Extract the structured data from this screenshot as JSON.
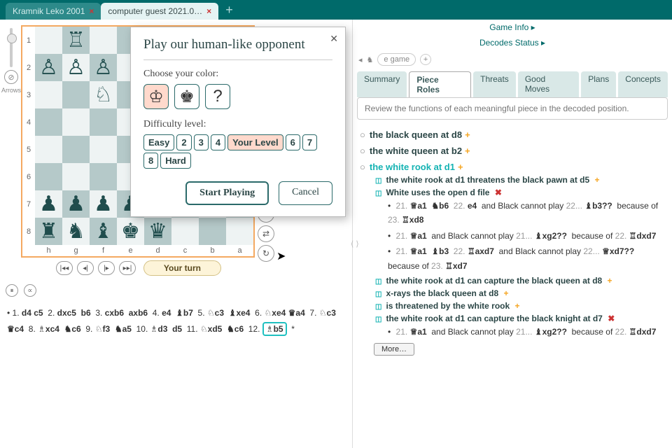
{
  "tabs": [
    {
      "label": "Kramnik Leko 2001",
      "active": false
    },
    {
      "label": "computer guest 2021.0…",
      "active": true
    }
  ],
  "sidebar": {
    "arrows": "Arrows"
  },
  "board": {
    "ranks": [
      "1",
      "2",
      "3",
      "4",
      "5",
      "6",
      "7",
      "8"
    ],
    "files": [
      "h",
      "g",
      "f",
      "e",
      "d",
      "c",
      "b",
      "a"
    ],
    "turn_badge": "Your turn"
  },
  "nav": {
    "first": "⏮",
    "prev": "◁",
    "next": "▷",
    "last": "⏭"
  },
  "notation_text": "• 1. d4 c5 2. dxc5 b6 3. cxb6 axb6 4. e4 ♝b7 5. ♘c3 ♝xe4 6. ♘xe4 ♛a4 7. ♘c3 ♛c4 8. ♗xc4 ♞c6 9. ♘f3 ♞a5 10. ♗d3 d5 11. ♘xd5 ♞c6 12. ♗b5 *",
  "notation_highlight": "♗b5",
  "right": {
    "game_info": "Game Info ▸",
    "decodes": "Decodes Status ▸",
    "chips": [
      "◂",
      "♞",
      "e game",
      "+"
    ],
    "tabs": [
      "Summary",
      "Piece Roles",
      "Threats",
      "Good Moves",
      "Plans",
      "Concepts"
    ],
    "current_tab": 1,
    "desc": "Review the functions of each meaningful piece in the decoded position."
  },
  "analysis": [
    {
      "type": "head",
      "text": "the black queen at d8",
      "mark": "+"
    },
    {
      "type": "head",
      "text": "the white queen at b2",
      "mark": "+"
    },
    {
      "type": "head",
      "text": "the white rook at d1",
      "mark": "+",
      "teal": true,
      "children": [
        {
          "type": "sub",
          "text": "the white rook at d1 threatens the black pawn at d5",
          "mark": "+"
        },
        {
          "type": "sub",
          "text": "White uses the open d file",
          "mark": "x",
          "lines": [
            "• 21. ♕a1 ♞b6 22. e4 and Black cannot play 22... ♝b3?? because of 23. ♖xd8",
            "• 21. ♕a1 and Black cannot play 21... ♝xg2?? because of 22. ♖dxd7",
            "• 21. ♕a1 ♝b3 22. ♖axd7 and Black cannot play 22... ♕xd7?? because of 23. ♖xd7"
          ]
        },
        {
          "type": "sub",
          "text": "the white rook at d1 can capture the black queen at d8",
          "mark": "+"
        },
        {
          "type": "sub",
          "text": "x-rays the black queen at d8",
          "mark": "+"
        },
        {
          "type": "sub",
          "text": "is threatened by the white rook",
          "mark": "+"
        },
        {
          "type": "sub",
          "text": "the white rook at d1 can capture the black knight at d7",
          "mark": "x",
          "lines": [
            "• 21. ♕a1 and Black cannot play 21... ♝xg2?? because of 22. ♖dxd7"
          ]
        }
      ]
    }
  ],
  "more": "More…",
  "modal": {
    "title": "Play our human-like opponent",
    "color_label": "Choose your color:",
    "colors": [
      "♔",
      "♚",
      "?"
    ],
    "color_sel": 0,
    "diff_label": "Difficulty level:",
    "diffs": [
      "Easy",
      "2",
      "3",
      "4",
      "Your Level",
      "6",
      "7",
      "8",
      "Hard"
    ],
    "diff_sel": 4,
    "start": "Start Playing",
    "cancel": "Cancel"
  }
}
